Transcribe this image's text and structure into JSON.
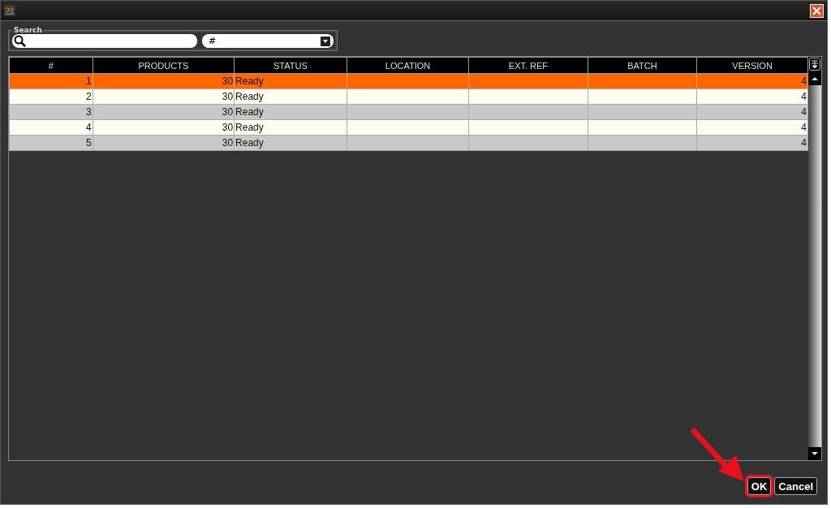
{
  "search": {
    "legend": "Search",
    "field_value": "#"
  },
  "table": {
    "columns": [
      "#",
      "PRODUCTS",
      "STATUS",
      "LOCATION",
      "EXT. REF",
      "BATCH",
      "VERSION"
    ],
    "rows": [
      {
        "selected": true,
        "cells": [
          "1",
          "30",
          "Ready",
          "",
          "",
          "",
          "4"
        ]
      },
      {
        "selected": false,
        "cells": [
          "2",
          "30",
          "Ready",
          "",
          "",
          "",
          "4"
        ]
      },
      {
        "selected": false,
        "cells": [
          "3",
          "30",
          "Ready",
          "",
          "",
          "",
          "4"
        ]
      },
      {
        "selected": false,
        "cells": [
          "4",
          "30",
          "Ready",
          "",
          "",
          "",
          "4"
        ]
      },
      {
        "selected": false,
        "cells": [
          "5",
          "30",
          "Ready",
          "",
          "",
          "",
          "4"
        ]
      }
    ]
  },
  "buttons": [
    {
      "label": "OK",
      "highlighted": true
    },
    {
      "label": "Cancel",
      "highlighted": false
    }
  ]
}
